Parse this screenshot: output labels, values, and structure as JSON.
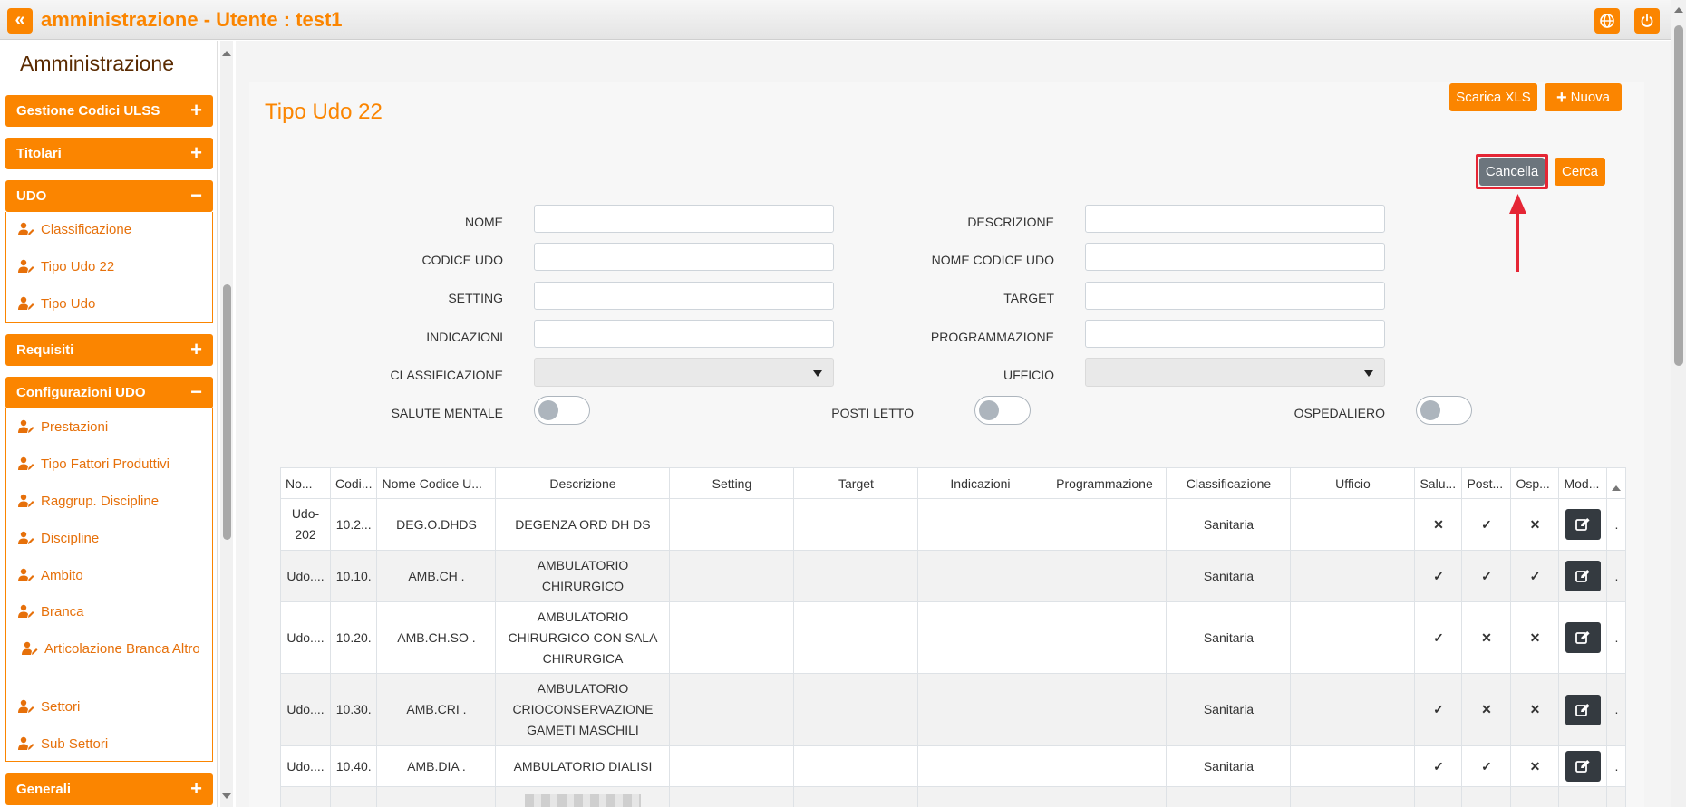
{
  "header": {
    "back_icon": "«",
    "title": "amministrazione - Utente : test1",
    "icons": [
      "globe-icon",
      "power-icon"
    ]
  },
  "sidebar": {
    "title": "Amministrazione",
    "sections": [
      {
        "label": "Gestione Codici ULSS",
        "sign": "+"
      },
      {
        "label": "Titolari",
        "sign": "+"
      },
      {
        "label": "UDO",
        "sign": "−",
        "items": [
          "Classificazione",
          "Tipo Udo 22",
          "Tipo Udo"
        ]
      },
      {
        "label": "Requisiti",
        "sign": "+"
      },
      {
        "label": "Configurazioni UDO",
        "sign": "−",
        "items": [
          "Prestazioni",
          "Tipo Fattori Produttivi",
          "Raggrup. Discipline",
          "Discipline",
          "Ambito",
          "Branca",
          "Articolazione Branca Altro",
          "Settori",
          "Sub Settori"
        ]
      },
      {
        "label": "Generali",
        "sign": "+"
      }
    ]
  },
  "page": {
    "title": "Tipo Udo 22",
    "buttons": {
      "download_xls": "Scarica XLS",
      "new_plus": "+",
      "new": "Nuova",
      "clear": "Cancella",
      "search": "Cerca"
    }
  },
  "filters": {
    "nome": "NOME",
    "descrizione": "DESCRIZIONE",
    "codice_udo": "CODICE UDO",
    "nome_codice_udo": "NOME CODICE UDO",
    "setting": "SETTING",
    "target": "TARGET",
    "indicazioni": "INDICAZIONI",
    "programmazione": "PROGRAMMAZIONE",
    "classificazione": "CLASSIFICAZIONE",
    "ufficio": "UFFICIO",
    "salute_mentale": "SALUTE MENTALE",
    "posti_letto": "POSTI LETTO",
    "ospedaliero": "OSPEDALIERO",
    "values": {
      "nome": "",
      "descrizione": "",
      "codice_udo": "",
      "nome_codice_udo": "",
      "setting": "",
      "target": "",
      "indicazioni": "",
      "programmazione": "",
      "classificazione": "",
      "ufficio": ""
    },
    "toggles": {
      "salute_mentale": false,
      "posti_letto": false,
      "ospedaliero": false
    }
  },
  "table": {
    "columns": [
      "No...",
      "Codi...",
      "Nome Codice U...",
      "Descrizione",
      "Setting",
      "Target",
      "Indicazioni",
      "Programmazione",
      "Classificazione",
      "Ufficio",
      "Salu...",
      "Post...",
      "Osp...",
      "Mod..."
    ],
    "rows": [
      {
        "nome": "Udo-202",
        "codice": "10.2...",
        "nome_codice": "DEG.O.DHDS",
        "descrizione": "DEGENZA ORD DH DS",
        "setting": "",
        "target": "",
        "indicazioni": "",
        "programmazione": "",
        "classificazione": "Sanitaria",
        "ufficio": "",
        "salute": "✕",
        "posti": "✓",
        "osp": "✕",
        "trail": "."
      },
      {
        "nome": "Udo....",
        "codice": "10.10.",
        "nome_codice": "AMB.CH .",
        "descrizione": "AMBULATORIO CHIRURGICO",
        "setting": "",
        "target": "",
        "indicazioni": "",
        "programmazione": "",
        "classificazione": "Sanitaria",
        "ufficio": "",
        "salute": "✓",
        "posti": "✓",
        "osp": "✓",
        "trail": "."
      },
      {
        "nome": "Udo....",
        "codice": "10.20.",
        "nome_codice": "AMB.CH.SO .",
        "descrizione": "AMBULATORIO CHIRURGICO CON SALA CHIRURGICA",
        "setting": "",
        "target": "",
        "indicazioni": "",
        "programmazione": "",
        "classificazione": "Sanitaria",
        "ufficio": "",
        "salute": "✓",
        "posti": "✕",
        "osp": "✕",
        "trail": "."
      },
      {
        "nome": "Udo....",
        "codice": "10.30.",
        "nome_codice": "AMB.CRI .",
        "descrizione": "AMBULATORIO CRIOCONSERVAZIONE GAMETI MASCHILI",
        "setting": "",
        "target": "",
        "indicazioni": "",
        "programmazione": "",
        "classificazione": "Sanitaria",
        "ufficio": "",
        "salute": "✓",
        "posti": "✕",
        "osp": "✕",
        "trail": "."
      },
      {
        "nome": "Udo....",
        "codice": "10.40.",
        "nome_codice": "AMB.DIA .",
        "descrizione": "AMBULATORIO DIALISI",
        "setting": "",
        "target": "",
        "indicazioni": "",
        "programmazione": "",
        "classificazione": "Sanitaria",
        "ufficio": "",
        "salute": "✓",
        "posti": "✓",
        "osp": "✕",
        "trail": "."
      }
    ]
  },
  "colors": {
    "accent": "#fb8500",
    "highlight": "#e52635",
    "edit_button": "#343a40",
    "clear_button": "#6c757d"
  }
}
